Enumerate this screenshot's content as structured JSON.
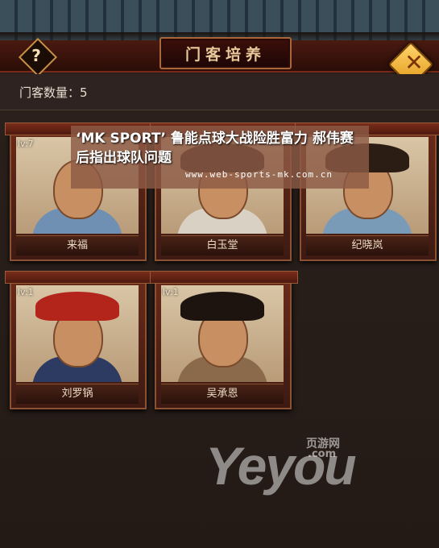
{
  "header": {
    "title": "门客培养",
    "help_icon": "question-mark-icon",
    "help_glyph": "?",
    "close_icon": "close-x-icon",
    "close_glyph": "✕"
  },
  "summary": {
    "count_label": "门客数量：5"
  },
  "retainers": [
    {
      "name": "来福",
      "level": "lv:7",
      "hat_color": "",
      "robe_color": "#6f8fb3"
    },
    {
      "name": "白玉堂",
      "level": "",
      "hat_color": "#2a1a14",
      "robe_color": "#d9d2c4"
    },
    {
      "name": "纪晓岚",
      "level": "",
      "hat_color": "#2b1d14",
      "robe_color": "#7a9bb8"
    },
    {
      "name": "刘罗锅",
      "level": "lv:1",
      "hat_color": "#b3241a",
      "robe_color": "#2d3b63"
    },
    {
      "name": "吴承恩",
      "level": "lv:1",
      "hat_color": "#1d1410",
      "robe_color": "#8a6a4a"
    }
  ],
  "banner": {
    "title": "‘MK SPORT’ 鲁能点球大战险胜富力 郝伟赛后指出球队问题",
    "url": "www.web-sports-mk.com.cn"
  },
  "watermark": {
    "logo": "Yeyou",
    "sub_cn": "页游网",
    "sub_en": ".com"
  }
}
